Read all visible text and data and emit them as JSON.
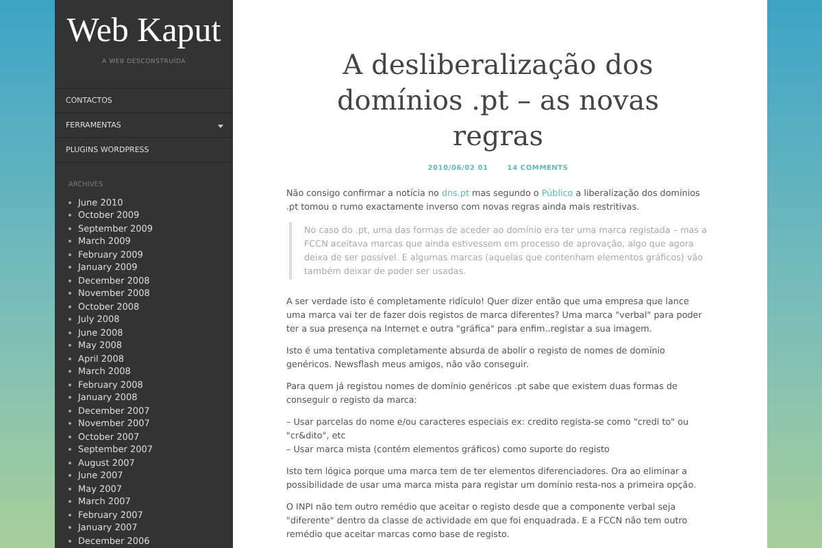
{
  "sidebar": {
    "site_title": "Web Kaput",
    "tagline": "A WEB DESCONSTRUÍDA",
    "nav": [
      {
        "label": "CONTACTOS",
        "expandable": false
      },
      {
        "label": "FERRAMENTAS",
        "expandable": true
      },
      {
        "label": "PLUGINS WORDPRESS",
        "expandable": false
      }
    ],
    "archives_heading": "ARCHIVES",
    "archives": [
      "June 2010",
      "October 2009",
      "September 2009",
      "March 2009",
      "February 2009",
      "January 2009",
      "December 2008",
      "November 2008",
      "October 2008",
      "July 2008",
      "June 2008",
      "May 2008",
      "April 2008",
      "March 2008",
      "February 2008",
      "January 2008",
      "December 2007",
      "November 2007",
      "October 2007",
      "September 2007",
      "August 2007",
      "June 2007",
      "May 2007",
      "March 2007",
      "February 2007",
      "January 2007",
      "December 2006"
    ]
  },
  "post": {
    "title": "A desliberalização dos domínios .pt – as novas regras",
    "date": "2010/06/02 01",
    "comments": "14 COMMENTS",
    "blocks": [
      {
        "kind": "paragraph",
        "parts": [
          {
            "kind": "text",
            "text": "Não consigo confirmar a notícia no "
          },
          {
            "kind": "link",
            "text": "dns.pt"
          },
          {
            "kind": "text",
            "text": " mas segundo o "
          },
          {
            "kind": "link",
            "text": "Público"
          },
          {
            "kind": "text",
            "text": " a liberalização dos domínios .pt tomou o rumo exactamente inverso com novas regras ainda mais restritivas."
          }
        ]
      },
      {
        "kind": "quote",
        "parts": [
          {
            "kind": "text",
            "text": "No caso do .pt, uma das formas de aceder ao domínio era ter uma marca registada – mas a FCCN aceitava marcas que ainda estivessem em processo de aprovação, algo que agora deixa de ser possível. E algumas marcas (aquelas que contenham elementos gráficos) vão também deixar de poder ser usadas."
          }
        ]
      },
      {
        "kind": "paragraph",
        "parts": [
          {
            "kind": "text",
            "text": "A ser verdade isto é completamente ridículo! Quer dizer então que uma empresa que lance uma marca vai ter de fazer dois registos de marca diferentes? Uma marca \"verbal\" para poder ter a sua presença na Internet e outra \"gráfica\" para enfim..registar a sua imagem."
          }
        ]
      },
      {
        "kind": "paragraph",
        "parts": [
          {
            "kind": "text",
            "text": "Isto é uma tentativa completamente absurda de abolir o registo de nomes de domínio genéricos. Newsflash meus amigos, não vão conseguir."
          }
        ]
      },
      {
        "kind": "paragraph",
        "parts": [
          {
            "kind": "text",
            "text": "Para quem já registou nomes de domínio genéricos .pt sabe que existem duas formas de conseguir o registo da marca:"
          }
        ]
      },
      {
        "kind": "lines",
        "lines": [
          "– Usar parcelas do nome e/ou caracteres especiais ex: credito regista-se como \"credi to\" ou \"cr&dito\", etc",
          "– Usar marca mista (contém elementos gráficos) como suporte do registo"
        ]
      },
      {
        "kind": "paragraph",
        "parts": [
          {
            "kind": "text",
            "text": "Isto tem lógica porque uma marca tem de ter elementos diferenciadores. Ora ao eliminar a possibilidade de usar uma marca mista para registar um domínio resta-nos a primeira opção."
          }
        ]
      },
      {
        "kind": "paragraph",
        "parts": [
          {
            "kind": "text",
            "text": "O INPI não tem outro remédio que aceitar o registo desde que a componente verbal seja \"diferente\" dentro da classe de actividade em que foi enquadrada. E a FCCN não tem outro remédio que aceitar marcas como base de registo."
          }
        ]
      }
    ]
  }
}
